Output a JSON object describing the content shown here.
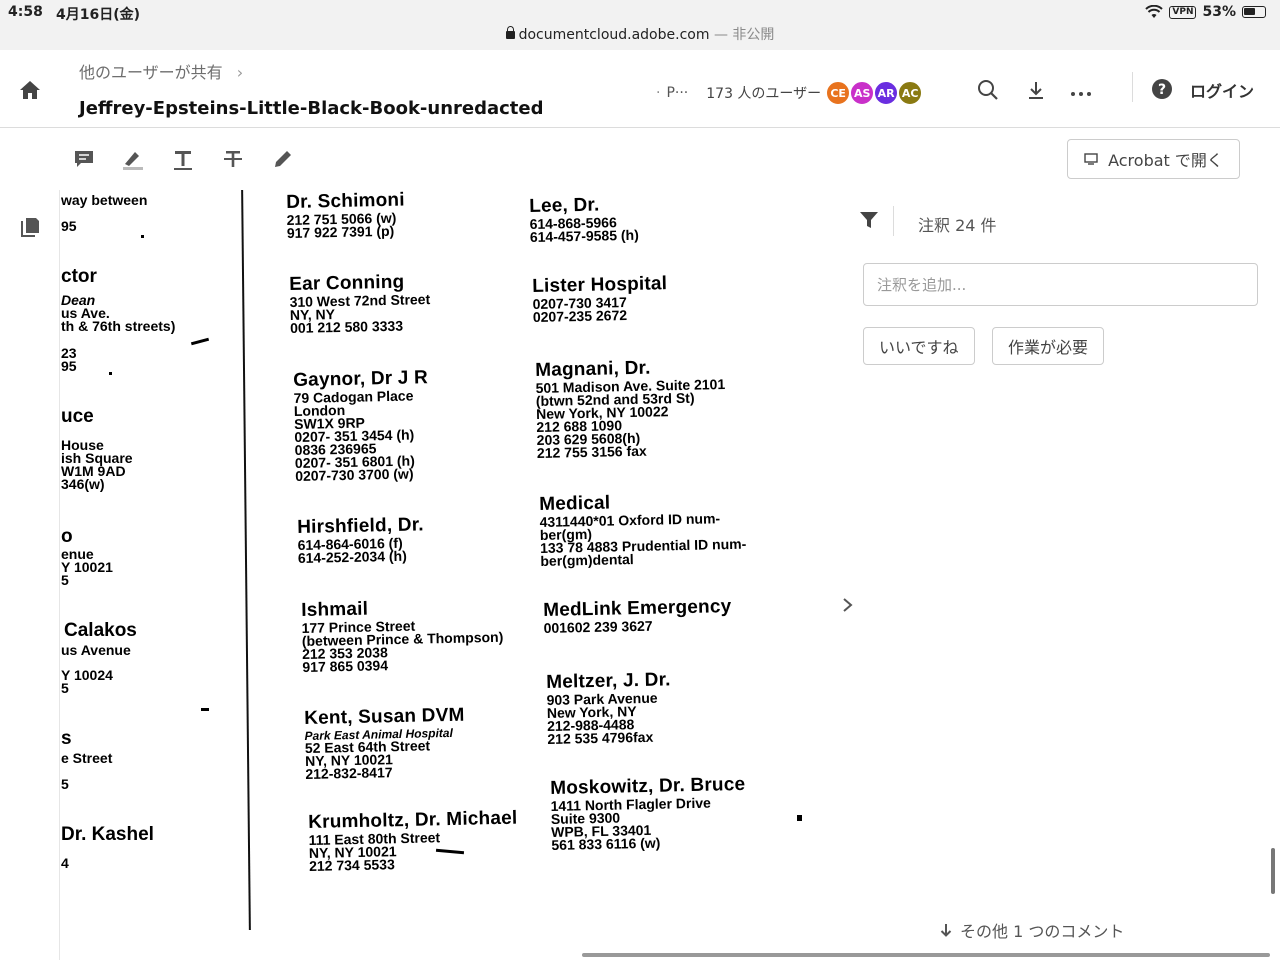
{
  "status_bar": {
    "time": "4:58",
    "date": "4月16日(金)",
    "vpn": "VPN",
    "battery": "53%",
    "url_domain": "documentcloud.adobe.com",
    "url_separator": "—",
    "url_privacy": "非公開"
  },
  "header": {
    "breadcrumb": "他のユーザーが共有",
    "title": "Jeffrey-Epsteins-Little-Black-Book-unredacted",
    "share_dot": "·",
    "share_page": "P···",
    "users_count": "173 人のユーザー",
    "avatars": [
      {
        "initials": "CE",
        "color": "#e8731e"
      },
      {
        "initials": "AS",
        "color": "#c930c9"
      },
      {
        "initials": "AR",
        "color": "#6a2ee0"
      },
      {
        "initials": "AC",
        "color": "#8a7a12"
      }
    ],
    "login": "ログイン"
  },
  "toolbar": {
    "open_in_acrobat": "Acrobat で開く"
  },
  "comments": {
    "count": "注釈 24 件",
    "placeholder": "注釈を追加...",
    "chip_like": "いいですね",
    "chip_action": "作業が必要",
    "more": "その他 1 つのコメント"
  },
  "document": {
    "left_fragments": [
      "way between",
      "95",
      "ctor",
      "Dean",
      "us Ave.",
      "th & 76th  streets)",
      "23",
      "95",
      "uce",
      "House",
      "ish Square",
      "W1M 9AD",
      "346(w)",
      "o",
      "enue",
      "Y 10021",
      "5",
      "Calakos",
      "us Avenue",
      "Y 10024",
      "5",
      "s",
      "e Street",
      "5",
      "Dr. Kashel",
      "4"
    ],
    "middle_column": [
      {
        "name": "Dr. Schimoni",
        "lines": [
          "212 751 5066 (w)",
          "917 922 7391 (p)"
        ]
      },
      {
        "name": "Ear Conning",
        "lines": [
          "310 West 72nd Street",
          "NY, NY",
          "001 212 580 3333"
        ]
      },
      {
        "name": "Gaynor, Dr J R",
        "lines": [
          "79 Cadogan Place",
          "London",
          "SW1X 9RP",
          "0207- 351 3454 (h)",
          "0836 236965",
          "0207- 351 6801 (h)",
          "0207-730 3700 (w)"
        ]
      },
      {
        "name": "Hirshfield, Dr.",
        "lines": [
          "614-864-6016 (f)",
          "614-252-2034 (h)"
        ]
      },
      {
        "name": "Ishmail",
        "lines": [
          "177 Prince Street",
          "(between Prince & Thompson)",
          "212 353 2038",
          "917 865 0394"
        ]
      },
      {
        "name": "Kent, Susan DVM",
        "italic": "Park East Animal Hospital",
        "lines": [
          "52 East 64th Street",
          "NY, NY 10021",
          "212-832-8417"
        ]
      },
      {
        "name": "Krumholtz, Dr. Michael",
        "lines": [
          "111 East 80th Street",
          "NY, NY 10021",
          "212 734 5533"
        ]
      }
    ],
    "right_column": [
      {
        "name": "Lee, Dr.",
        "lines": [
          "614-868-5966",
          "614-457-9585 (h)"
        ]
      },
      {
        "name": "Lister Hospital",
        "lines": [
          "0207-730 3417",
          "0207-235 2672"
        ]
      },
      {
        "name": "Magnani, Dr.",
        "lines": [
          "501 Madison Ave.  Suite 2101",
          "(btwn 52nd and 53rd St)",
          "New York, NY 10022",
          "212 688 1090",
          "203 629 5608(h)",
          "212 755 3156 fax"
        ]
      },
      {
        "name": "Medical",
        "lines": [
          "4311440*01 Oxford ID num-",
          "ber(gm)",
          "133 78 4883 Prudential ID num-",
          "ber(gm)dental"
        ]
      },
      {
        "name": "MedLink Emergency",
        "lines": [
          "001602 239 3627"
        ]
      },
      {
        "name": "Meltzer, J. Dr.",
        "lines": [
          "903 Park Avenue",
          "New York, NY",
          "212-988-4488",
          "212 535 4796fax"
        ]
      },
      {
        "name": "Moskowitz, Dr. Bruce",
        "lines": [
          "1411 North Flagler Drive",
          "Suite 9300",
          "WPB, FL 33401",
          "561 833 6116 (w)"
        ]
      }
    ]
  }
}
